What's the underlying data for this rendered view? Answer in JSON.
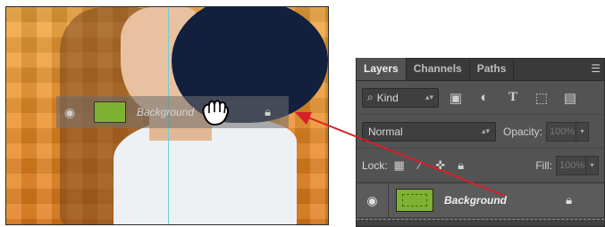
{
  "canvas": {
    "drag_ghost": {
      "layer_name": "Background",
      "eye_icon": "eye-icon",
      "lock_icon": "lock-icon"
    },
    "cursor_icon": "hand-grab-cursor"
  },
  "layers_panel": {
    "tabs": [
      {
        "label": "Layers",
        "active": true
      },
      {
        "label": "Channels",
        "active": false
      },
      {
        "label": "Paths",
        "active": false
      }
    ],
    "filter": {
      "kind_label": "Kind",
      "filter_icons": [
        "image-filter-icon",
        "adjustment-filter-icon",
        "type-filter-icon",
        "shape-filter-icon",
        "smart-object-filter-icon"
      ]
    },
    "blend_mode": "Normal",
    "opacity_label": "Opacity:",
    "opacity_value": "100%",
    "lock_label": "Lock:",
    "lock_icons": [
      "lock-transparent-icon",
      "lock-image-icon",
      "lock-position-icon",
      "lock-all-icon"
    ],
    "fill_label": "Fill:",
    "fill_value": "100%",
    "layers": [
      {
        "name": "Background",
        "visible": true,
        "locked": true
      }
    ]
  },
  "colors": {
    "panel_bg": "#535353",
    "tab_bar": "#3a3a3a",
    "arrow": "#d6202a",
    "canvas_orange": "#ec9a2e",
    "layer_thumb": "#7fb232"
  }
}
